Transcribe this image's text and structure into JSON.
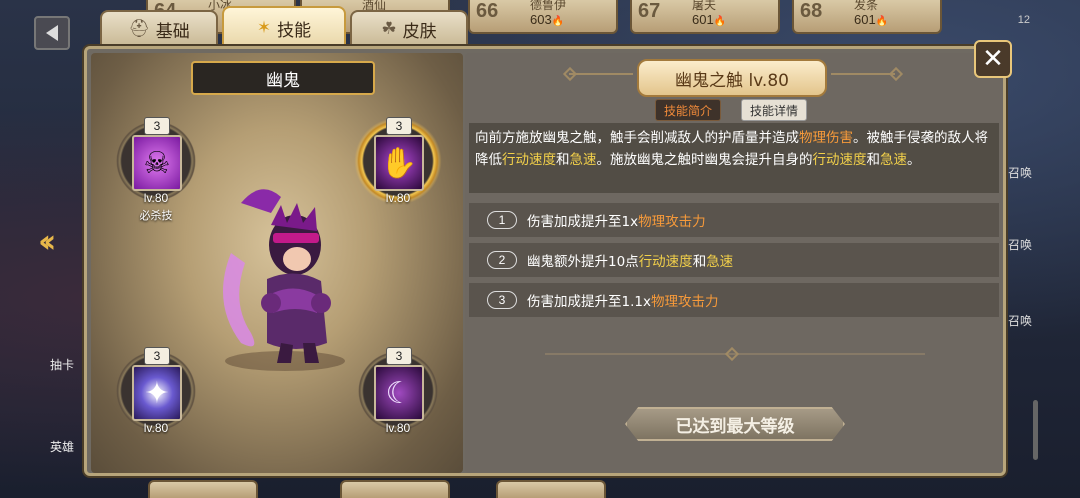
{
  "background": {
    "top_cards": [
      {
        "num": "64",
        "name": "小冰",
        "val": ""
      },
      {
        "num": "",
        "name": "酒仙",
        "val": ""
      },
      {
        "num": "66",
        "name": "德鲁伊",
        "val": "603"
      },
      {
        "num": "67",
        "name": "屠夫",
        "val": "601"
      },
      {
        "num": "68",
        "name": "发条",
        "val": "601"
      }
    ],
    "counter": "12",
    "left_items": [
      "抽卡",
      "英雄"
    ],
    "right_items": [
      "召唤",
      "召唤",
      "召唤"
    ]
  },
  "tabs": [
    {
      "label": "基础",
      "icon": "helmet-icon",
      "active": false
    },
    {
      "label": "技能",
      "icon": "star-icon",
      "active": true
    },
    {
      "label": "皮肤",
      "icon": "clover-icon",
      "active": false
    }
  ],
  "hero": {
    "name": "幽鬼"
  },
  "skills": [
    {
      "level_badge": "3",
      "lv": "lv.80",
      "tag": "必杀技",
      "icon": "ghost-skull-icon",
      "color": "#a13ad0"
    },
    {
      "level_badge": "3",
      "lv": "lv.80",
      "tag": "",
      "icon": "shadow-hand-icon",
      "color": "#5a1a70",
      "selected": true
    },
    {
      "level_badge": "3",
      "lv": "lv.80",
      "tag": "",
      "icon": "dagger-burst-icon",
      "color": "#4a3aa0"
    },
    {
      "level_badge": "3",
      "lv": "lv.80",
      "tag": "",
      "icon": "crescent-moon-icon",
      "color": "#4a1a5a"
    }
  ],
  "detail": {
    "title": "幽鬼之触 lv.80",
    "subtab_intro": "技能简介",
    "subtab_detail": "技能详情",
    "desc_parts": [
      {
        "t": "向前方施放幽鬼之触，触手会削减敌人的护盾量并造成",
        "c": ""
      },
      {
        "t": "物理伤害",
        "c": "orange"
      },
      {
        "t": "。被触手侵袭的敌人将降低",
        "c": ""
      },
      {
        "t": "行动速度",
        "c": "yellow"
      },
      {
        "t": "和",
        "c": ""
      },
      {
        "t": "急速",
        "c": "yellow"
      },
      {
        "t": "。施放幽鬼之触时幽鬼会提升自身的",
        "c": ""
      },
      {
        "t": "行动速度",
        "c": "yellow"
      },
      {
        "t": "和",
        "c": ""
      },
      {
        "t": "急速",
        "c": "yellow"
      },
      {
        "t": "。",
        "c": ""
      }
    ],
    "effects": [
      {
        "num": "1",
        "parts": [
          {
            "t": "伤害加成提升至1x",
            "c": ""
          },
          {
            "t": "物理攻击力",
            "c": "orange"
          }
        ]
      },
      {
        "num": "2",
        "parts": [
          {
            "t": "幽鬼额外提升10点",
            "c": ""
          },
          {
            "t": "行动速度",
            "c": "yellow"
          },
          {
            "t": "和",
            "c": ""
          },
          {
            "t": "急速",
            "c": "yellow"
          }
        ]
      },
      {
        "num": "3",
        "parts": [
          {
            "t": "伤害加成提升至1.1x",
            "c": ""
          },
          {
            "t": "物理攻击力",
            "c": "orange"
          }
        ]
      }
    ],
    "max_level_label": "已达到最大等级"
  },
  "colors": {
    "accent_gold": "#d7a94b",
    "highlight_orange": "#f79a3a",
    "highlight_yellow": "#f2d04a"
  }
}
